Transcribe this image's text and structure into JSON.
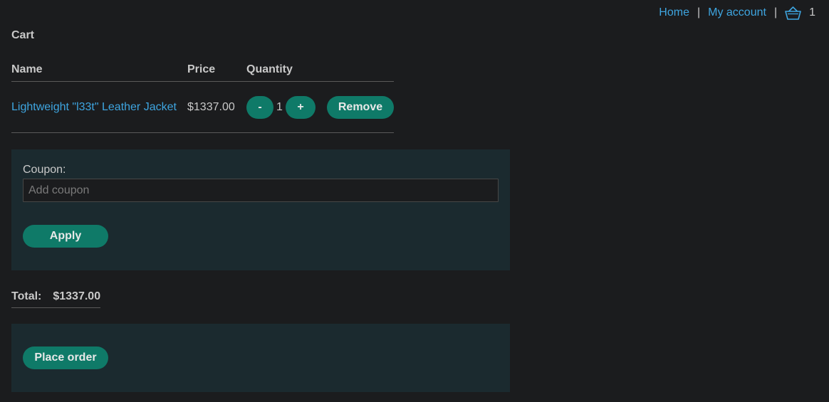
{
  "nav": {
    "home": "Home",
    "my_account": "My account",
    "separator": "|",
    "cart_count": "1"
  },
  "cart": {
    "title": "Cart",
    "columns": {
      "name": "Name",
      "price": "Price",
      "quantity": "Quantity"
    },
    "items": [
      {
        "name": "Lightweight \"l33t\" Leather Jacket",
        "price": "$1337.00",
        "quantity": "1",
        "minus_label": "-",
        "plus_label": "+",
        "remove_label": "Remove"
      }
    ]
  },
  "coupon": {
    "label": "Coupon:",
    "placeholder": "Add coupon",
    "apply_label": "Apply"
  },
  "total": {
    "label": "Total:",
    "value": "$1337.00"
  },
  "order": {
    "place_order_label": "Place order"
  },
  "colors": {
    "background": "#1b1c1e",
    "panel": "#1b2a2f",
    "button": "#0f7a68",
    "link": "#3ea5e0"
  },
  "icons": {
    "cart": "basket-icon"
  }
}
